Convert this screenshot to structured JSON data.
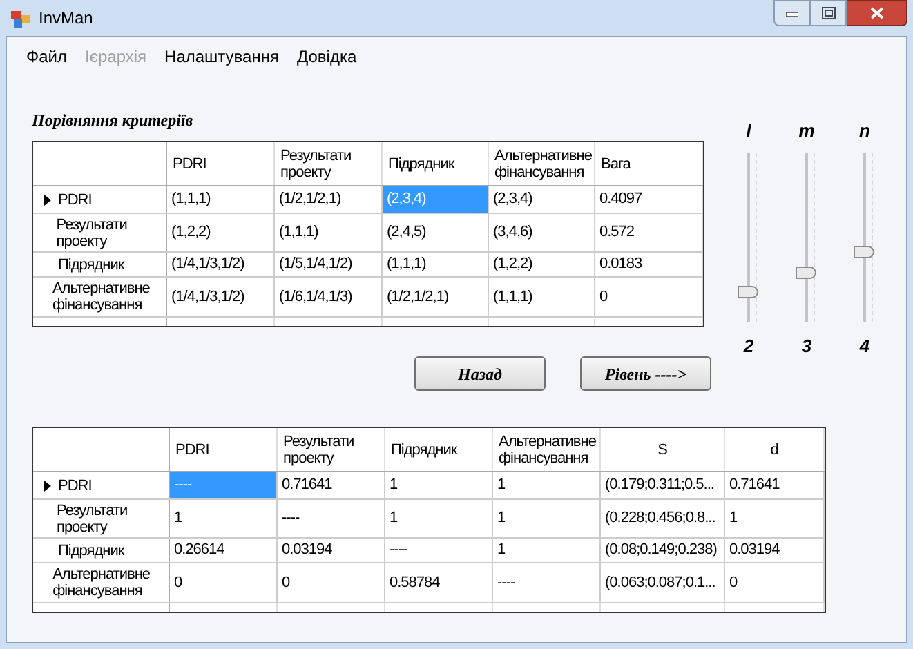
{
  "window": {
    "title": "InvMan"
  },
  "menu": [
    {
      "label": "Файл",
      "disabled": false
    },
    {
      "label": "Ієрархія",
      "disabled": true
    },
    {
      "label": "Налаштування",
      "disabled": false
    },
    {
      "label": "Довідка",
      "disabled": false
    }
  ],
  "section_title": "Порівняння критеріїв",
  "criteria_table": {
    "columns": [
      "PDRI",
      "Результати проекту",
      "Підрядник",
      "Альтернативне фінансування",
      "Вага"
    ],
    "rows": [
      {
        "header": "PDRI",
        "current": true,
        "cells": [
          {
            "text": "(1,1,1)",
            "selected": false
          },
          {
            "text": "(1/2,1/2,1)",
            "selected": false
          },
          {
            "text": "(2,3,4)",
            "selected": true
          },
          {
            "text": "(2,3,4)",
            "selected": false
          },
          {
            "text": "0.4097",
            "selected": false
          }
        ]
      },
      {
        "header": "Результати проекту",
        "current": false,
        "cells": [
          {
            "text": "(1,2,2)",
            "selected": false
          },
          {
            "text": "(1,1,1)",
            "selected": false
          },
          {
            "text": "(2,4,5)",
            "selected": false
          },
          {
            "text": "(3,4,6)",
            "selected": false
          },
          {
            "text": "0.572",
            "selected": false
          }
        ]
      },
      {
        "header": "Підрядник",
        "current": false,
        "cells": [
          {
            "text": "(1/4,1/3,1/2)",
            "selected": false
          },
          {
            "text": "(1/5,1/4,1/2)",
            "selected": false
          },
          {
            "text": "(1,1,1)",
            "selected": false
          },
          {
            "text": "(1,2,2)",
            "selected": false
          },
          {
            "text": "0.0183",
            "selected": false
          }
        ]
      },
      {
        "header": "Альтернативне фінансування",
        "current": false,
        "cells": [
          {
            "text": "(1/4,1/3,1/2)",
            "selected": false
          },
          {
            "text": "(1/6,1/4,1/3)",
            "selected": false
          },
          {
            "text": "(1/2,1/2,1)",
            "selected": false
          },
          {
            "text": "(1,1,1)",
            "selected": false
          },
          {
            "text": "0",
            "selected": false
          }
        ]
      }
    ]
  },
  "sliders": [
    {
      "name": "l",
      "level": 0.15,
      "value": "2"
    },
    {
      "name": "m",
      "level": 0.27,
      "value": "3"
    },
    {
      "name": "n",
      "level": 0.4,
      "value": "4"
    }
  ],
  "buttons": [
    "Назад",
    "Рівень ---->"
  ],
  "result_table": {
    "columns": [
      "PDRI",
      "Результати проекту",
      "Підрядник",
      "Альтернативне фінансування",
      "S",
      "d"
    ],
    "rows": [
      {
        "header": "PDRI",
        "current": true,
        "cells": [
          {
            "text": "----",
            "selected": true
          },
          {
            "text": "0.71641",
            "selected": false
          },
          {
            "text": "1",
            "selected": false
          },
          {
            "text": "1",
            "selected": false
          },
          {
            "text": "(0.179;0.311;0.5...",
            "selected": false
          },
          {
            "text": "0.71641",
            "selected": false
          }
        ]
      },
      {
        "header": "Результати проекту",
        "current": false,
        "cells": [
          {
            "text": "1",
            "selected": false
          },
          {
            "text": "----",
            "selected": false
          },
          {
            "text": "1",
            "selected": false
          },
          {
            "text": "1",
            "selected": false
          },
          {
            "text": "(0.228;0.456;0.8...",
            "selected": false
          },
          {
            "text": "1",
            "selected": false
          }
        ]
      },
      {
        "header": "Підрядник",
        "current": false,
        "cells": [
          {
            "text": "0.26614",
            "selected": false
          },
          {
            "text": "0.03194",
            "selected": false
          },
          {
            "text": "----",
            "selected": false
          },
          {
            "text": "1",
            "selected": false
          },
          {
            "text": "(0.08;0.149;0.238)",
            "selected": false
          },
          {
            "text": "0.03194",
            "selected": false
          }
        ]
      },
      {
        "header": "Альтернативне фінансування",
        "current": false,
        "cells": [
          {
            "text": "0",
            "selected": false
          },
          {
            "text": "0",
            "selected": false
          },
          {
            "text": "0.58784",
            "selected": false
          },
          {
            "text": "----",
            "selected": false
          },
          {
            "text": "(0.063;0.087;0.1...",
            "selected": false
          },
          {
            "text": "0",
            "selected": false
          }
        ]
      }
    ]
  }
}
